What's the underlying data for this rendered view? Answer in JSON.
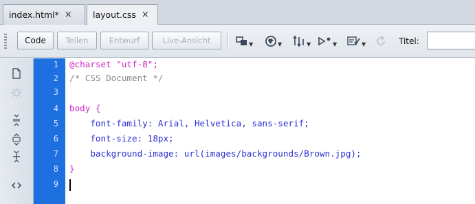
{
  "tabs": [
    {
      "label": "index.html*",
      "close": "×",
      "active": false
    },
    {
      "label": "layout.css",
      "close": "×",
      "active": true
    }
  ],
  "toolbar": {
    "views": [
      {
        "label": "Code",
        "enabled": true
      },
      {
        "label": "Teilen",
        "enabled": false
      },
      {
        "label": "Entwurf",
        "enabled": false
      },
      {
        "label": "Live-Ansicht",
        "enabled": false
      }
    ],
    "icons": [
      "multiscreen-icon",
      "preview-browser-icon",
      "file-management-icon",
      "live-code-icon",
      "validate-icon",
      "refresh-icon"
    ],
    "title_label": "Titel:",
    "title_value": ""
  },
  "editor": {
    "side_icons": [
      "open-documents-icon",
      "show-code-navigator-icon",
      "collapse-full-tag-icon",
      "collapse-selection-icon",
      "expand-all-icon",
      "apply-source-formatting-icon"
    ],
    "line_numbers": [
      "1",
      "2",
      "3",
      "4",
      "5",
      "6",
      "7",
      "8",
      "9"
    ],
    "lines": {
      "l1": "@charset \"utf-8\";",
      "l2": "/* CSS Document */",
      "l3": "",
      "l4": "body {",
      "l5": "    font-family: Arial, Helvetica, sans-serif;",
      "l6": "    font-size: 18px;",
      "l7": "    background-image: url(images/backgrounds/Brown.jpg);",
      "l8": "}",
      "l9": ""
    },
    "colors": {
      "gutter": "#1e6fe0",
      "keyword": "#cc29c4",
      "property": "#2a2fd0",
      "comment": "#8a8a8a"
    }
  }
}
